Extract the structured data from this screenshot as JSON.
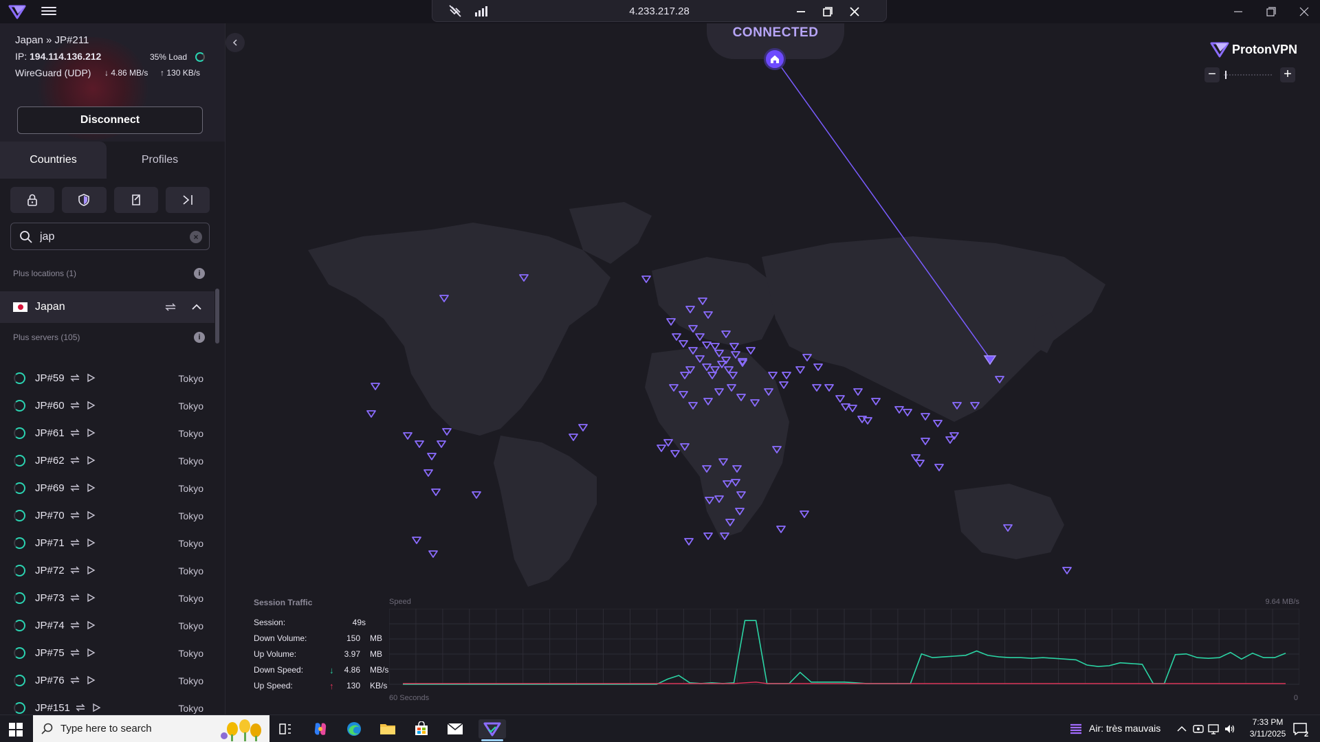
{
  "titlebar": {
    "ip": "4.233.217.28"
  },
  "connection": {
    "location": "Japan » JP#211",
    "ip_label": "IP:",
    "ip_value": "194.114.136.212",
    "load": "35% Load",
    "protocol": "WireGuard (UDP)",
    "down_speed": "4.86 MB/s",
    "up_speed": "130 KB/s",
    "disconnect_label": "Disconnect"
  },
  "tabs": [
    "Countries",
    "Profiles"
  ],
  "search": {
    "value": "jap"
  },
  "sections": {
    "plus_locations": "Plus locations (1)",
    "plus_servers": "Plus servers (105)"
  },
  "country": {
    "name": "Japan"
  },
  "servers": [
    {
      "name": "JP#59",
      "city": "Tokyo"
    },
    {
      "name": "JP#60",
      "city": "Tokyo"
    },
    {
      "name": "JP#61",
      "city": "Tokyo"
    },
    {
      "name": "JP#62",
      "city": "Tokyo"
    },
    {
      "name": "JP#69",
      "city": "Tokyo"
    },
    {
      "name": "JP#70",
      "city": "Tokyo"
    },
    {
      "name": "JP#71",
      "city": "Tokyo"
    },
    {
      "name": "JP#72",
      "city": "Tokyo"
    },
    {
      "name": "JP#73",
      "city": "Tokyo"
    },
    {
      "name": "JP#74",
      "city": "Tokyo"
    },
    {
      "name": "JP#75",
      "city": "Tokyo"
    },
    {
      "name": "JP#76",
      "city": "Tokyo"
    },
    {
      "name": "JP#151",
      "city": "Tokyo"
    }
  ],
  "map": {
    "status": "CONNECTED",
    "brand": "ProtonVPN"
  },
  "stats": {
    "title": "Session Traffic",
    "rows": [
      {
        "label": "Session:",
        "value": "49s",
        "unit": ""
      },
      {
        "label": "Down Volume:",
        "value": "150",
        "unit": "MB"
      },
      {
        "label": "Up Volume:",
        "value": "3.97",
        "unit": "MB"
      },
      {
        "label": "Down Speed:",
        "value": "4.86",
        "unit": "MB/s",
        "arrow": "↓"
      },
      {
        "label": "Up Speed:",
        "value": "130",
        "unit": "KB/s",
        "arrow": "↑"
      }
    ]
  },
  "speed_chart": {
    "label": "Speed",
    "max_label": "9.64 MB/s",
    "x_label": "60 Seconds",
    "zero_label": "0",
    "colors": {
      "download": "#2bd4a4",
      "upload": "#e8345a"
    },
    "download": [
      0,
      0,
      0,
      0,
      0,
      0,
      0,
      0,
      0,
      0,
      0,
      0,
      0,
      0,
      0,
      0,
      0,
      0,
      0,
      0,
      0,
      0,
      0,
      0,
      0.7,
      1.2,
      0.2,
      0.1,
      0.2,
      0.1,
      0.2,
      8.6,
      8.6,
      0.1,
      0.1,
      0.1,
      1.6,
      0.3,
      0.3,
      0.3,
      0.3,
      0.2,
      0.1,
      0.1,
      0.1,
      0.1,
      0.1,
      4.1,
      3.6,
      3.7,
      3.8,
      3.9,
      4.5,
      3.9,
      3.7,
      3.6,
      3.6,
      3.5,
      3.6,
      3.5,
      3.4,
      3.3,
      2.6,
      2.4,
      2.5,
      2.9,
      2.8,
      2.7,
      0.1,
      0.1,
      4.0,
      4.1,
      3.6,
      3.5,
      3.6,
      4.3,
      3.4,
      4.2,
      3.6,
      3.6,
      4.2
    ],
    "upload": [
      0.1,
      0.1,
      0.1,
      0.1,
      0.1,
      0.1,
      0.1,
      0.1,
      0.1,
      0.1,
      0.1,
      0.1,
      0.1,
      0.1,
      0.1,
      0.1,
      0.1,
      0.1,
      0.1,
      0.1,
      0.1,
      0.1,
      0.1,
      0.1,
      0.1,
      0.1,
      0.1,
      0.1,
      0.1,
      0.1,
      0.1,
      0.2,
      0.3,
      0.1,
      0.1,
      0.1,
      0.1,
      0.1,
      0.1,
      0.1,
      0.1,
      0.1,
      0.1,
      0.1,
      0.1,
      0.1,
      0.1,
      0.1,
      0.1,
      0.1,
      0.1,
      0.1,
      0.1,
      0.1,
      0.1,
      0.1,
      0.1,
      0.1,
      0.1,
      0.1,
      0.1,
      0.1,
      0.1,
      0.1,
      0.1,
      0.1,
      0.1,
      0.1,
      0.1,
      0.1,
      0.1,
      0.1,
      0.1,
      0.1,
      0.1,
      0.1,
      0.1,
      0.1,
      0.1,
      0.1,
      0.1
    ],
    "y_max": 9.64
  },
  "taskbar": {
    "search_placeholder": "Type here to search",
    "air_quality": "Air: très mauvais",
    "time": "7:33 PM",
    "date": "3/11/2025",
    "notif_count": "2"
  }
}
